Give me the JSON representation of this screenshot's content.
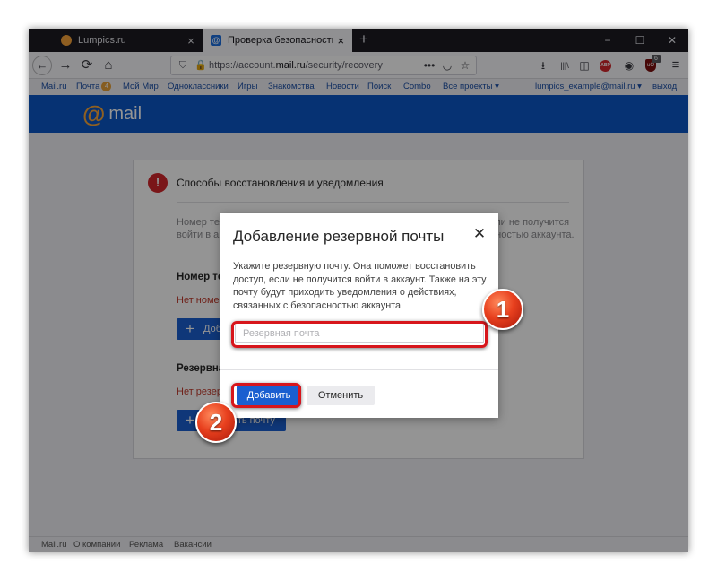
{
  "browser": {
    "tabs": [
      {
        "title": "Lumpics.ru",
        "close": "×"
      },
      {
        "title": "Проверка безопасности",
        "favicon": "@",
        "close": "×"
      }
    ],
    "new_tab": "+",
    "window_controls": {
      "minimize": "−",
      "maximize": "☐",
      "close": "✕"
    },
    "nav": {
      "back": "←",
      "forward": "→",
      "reload": "⟳",
      "home": "⌂"
    },
    "url": {
      "prefix": "https://account.",
      "domain": "mail.ru",
      "path": "/security/recovery"
    },
    "url_icons": {
      "shield": "⛉",
      "lock": "🔒",
      "more": "•••",
      "pocket": "◡",
      "bookmark": "☆"
    },
    "toolbar_icons": {
      "download": "⭳",
      "library": "|||\\",
      "sidebar": "◫",
      "adblock": "ABP",
      "account": "◉",
      "ublock": "uO",
      "ublock_badge": "6",
      "menu": "≡"
    }
  },
  "portal_menu": {
    "items": [
      "Mail.ru",
      "Почта",
      "Мой Мир",
      "Одноклассники",
      "Игры",
      "Знакомства",
      "Новости",
      "Поиск",
      "Combo",
      "Все проекты ▾"
    ],
    "mail_badge": "4",
    "user": "lumpics_example@mail.ru ▾",
    "logout": "выход"
  },
  "brand": {
    "at": "@",
    "name": "mail"
  },
  "card": {
    "alert_icon": "!",
    "title": "Способы восстановления и уведомления",
    "text": "Номер телефона и резервная почта помогут восстановить доступ, если не получится войти в аккаунт, а также получать уведомления, связанные с безопасностью аккаунта.",
    "phone_heading": "Номер телефона",
    "phone_none": "Нет номера телефона",
    "phone_button": "Добавить телефон",
    "email_heading": "Резервная почта",
    "email_none": "Нет резервной почты",
    "email_button": "Добавить почту"
  },
  "modal": {
    "title": "Добавление резервной почты",
    "close": "✕",
    "description": "Укажите резервную почту. Она поможет восстановить доступ, если не получится войти в аккаунт. Также на эту почту будут приходить уведомления о действиях, связанных с безопасностью аккаунта.",
    "input_value": "",
    "input_placeholder": "Резервная почта",
    "add_button": "Добавить",
    "cancel_button": "Отменить"
  },
  "footer": {
    "items": [
      "Mail.ru",
      "О компании",
      "Реклама",
      "Вакансии"
    ]
  },
  "annotations": {
    "marker_1": "1",
    "marker_2": "2"
  },
  "colors": {
    "brand_blue": "#0b57c6",
    "button_blue": "#1a5fd0",
    "mail_orange": "#f7a53a",
    "alert_red": "#d3262b",
    "annotation_red": "#d7161c"
  }
}
